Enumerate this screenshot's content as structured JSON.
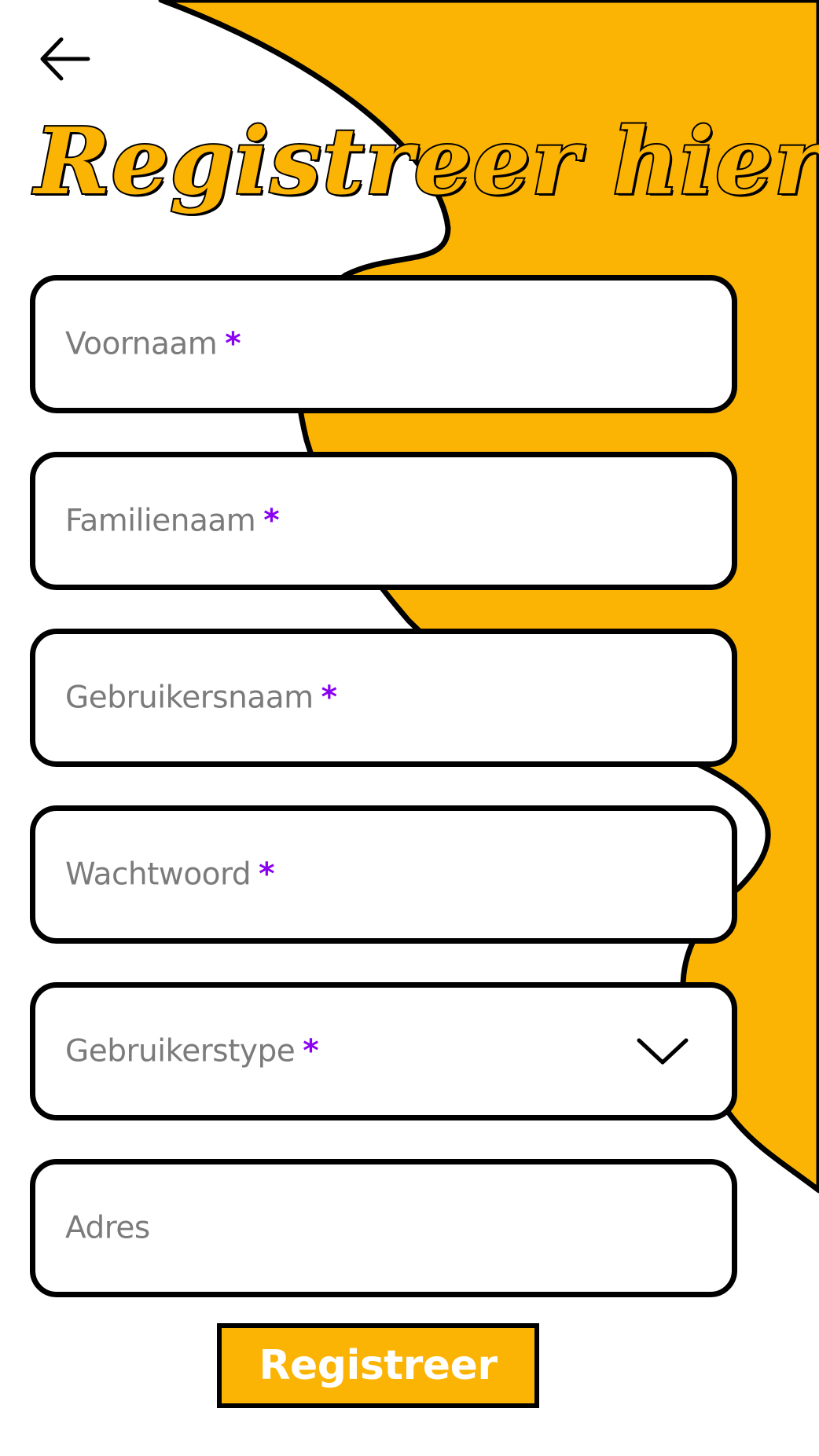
{
  "theme": {
    "accent": "#fcb404",
    "required_mark_color": "#8a00f0",
    "label_color": "#7b7b7b",
    "border_color": "#000000"
  },
  "header": {
    "back_icon": "arrow-left-icon",
    "title": "Registreer hier"
  },
  "form": {
    "required_mark": "*",
    "fields": [
      {
        "label": "Voornaam",
        "required": true
      },
      {
        "label": "Familienaam",
        "required": true
      },
      {
        "label": "Gebruikersnaam",
        "required": true
      },
      {
        "label": "Wachtwoord",
        "required": true
      },
      {
        "label": "Gebruikerstype",
        "required": true,
        "icon": "chevron-down-icon"
      },
      {
        "label": "Adres",
        "required": false
      }
    ],
    "submit_label": "Registreer"
  }
}
